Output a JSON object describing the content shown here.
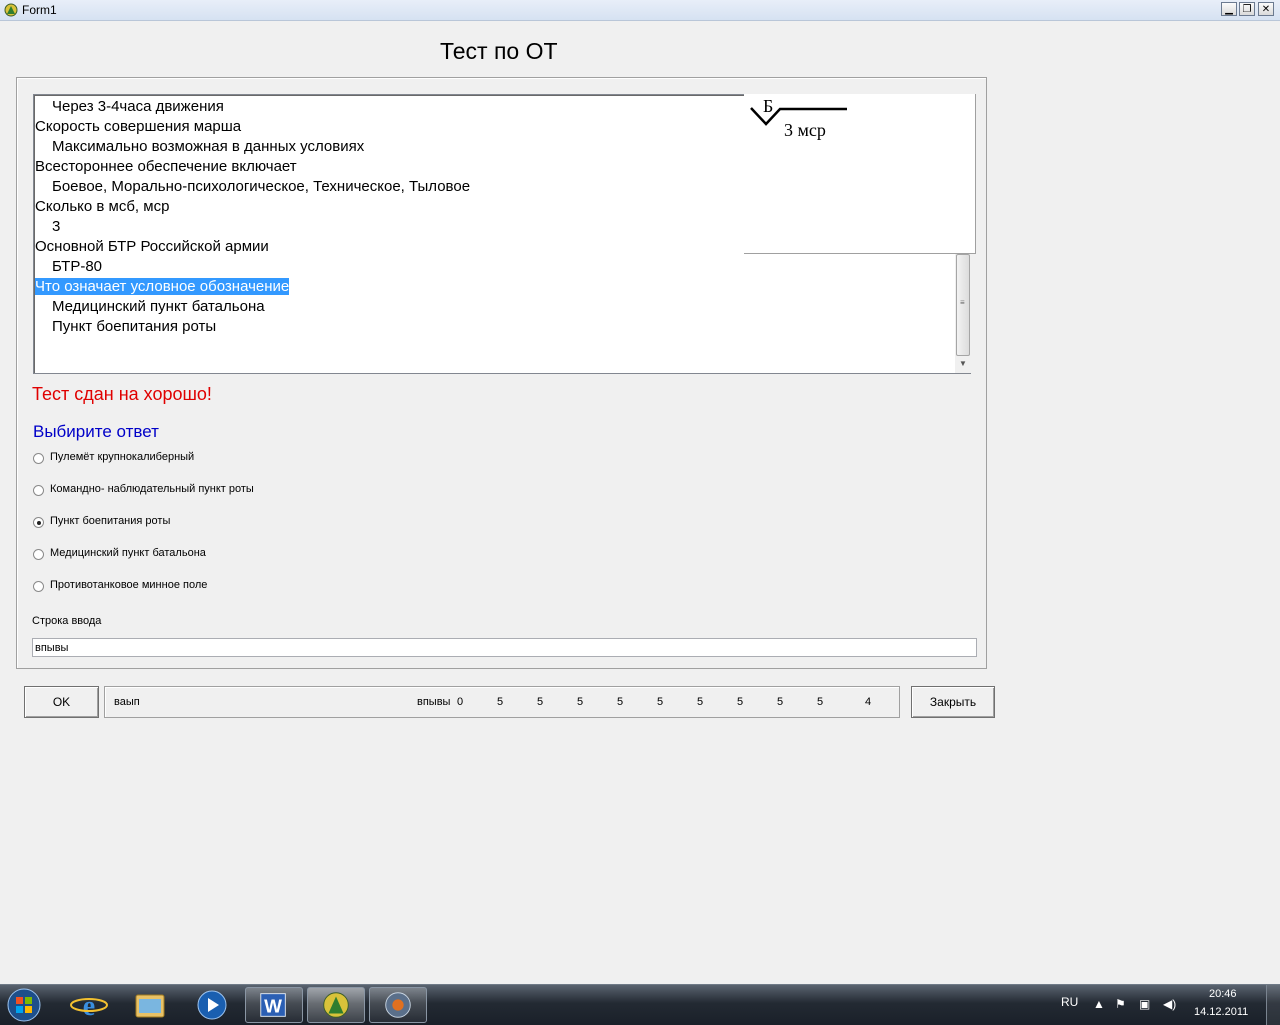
{
  "window": {
    "title": "Form1",
    "icon": "app-icon",
    "controls": {
      "minimize": "minimize-icon",
      "maximize": "restore-icon",
      "close": "close-icon"
    }
  },
  "form_title": "Тест по ОТ",
  "qa_list": [
    {
      "text": "Через 3-4часа движения",
      "type": "answer"
    },
    {
      "text": "Скорость совершения марша",
      "type": "question"
    },
    {
      "text": "Максимально возможная в данных условиях",
      "type": "answer"
    },
    {
      "text": "Всестороннее обеспечение включает",
      "type": "question"
    },
    {
      "text": "Боевое, Морально-психологическое, Техническое, Тыловое",
      "type": "answer"
    },
    {
      "text": "Сколько в мсб, мср",
      "type": "question"
    },
    {
      "text": "3",
      "type": "answer"
    },
    {
      "text": "Основной БТР Российской армии",
      "type": "question"
    },
    {
      "text": "БТР-80",
      "type": "answer"
    },
    {
      "text": "Что означает условное обозначение",
      "type": "question",
      "selected": true
    },
    {
      "text": "Медицинский пункт батальона",
      "type": "answer"
    },
    {
      "text": "Пункт боепитания роты",
      "type": "answer"
    }
  ],
  "symbol": {
    "letter": "Б",
    "label": "3 мср"
  },
  "result_text": "Тест сдан на хорошо!",
  "prompt_text": "Выбирите ответ",
  "options": [
    {
      "label": "Пулемёт крупнокалиберный",
      "checked": false
    },
    {
      "label": "Командно- наблюдательный пункт роты",
      "checked": false
    },
    {
      "label": "Пункт боепитания роты",
      "checked": true
    },
    {
      "label": "Медицинский пункт батальона",
      "checked": false
    },
    {
      "label": "Противотанковое минное поле",
      "checked": false
    }
  ],
  "input": {
    "label": "Строка ввода",
    "value": "впывы"
  },
  "buttons": {
    "ok": "OK",
    "close": "Закрыть"
  },
  "status": {
    "left_text": "ваып",
    "right_label": "впывы",
    "scores": [
      "0",
      "5",
      "5",
      "5",
      "5",
      "5",
      "5",
      "5",
      "5",
      "5",
      "4"
    ]
  },
  "taskbar": {
    "apps": [
      "internet-explorer-icon",
      "file-explorer-icon",
      "media-player-icon",
      "word-icon",
      "app-icon",
      "media-center-icon"
    ],
    "language": "RU",
    "time": "20:46",
    "date": "14.12.2011",
    "tray_icons": [
      "tray-arrow-icon",
      "flag-icon",
      "network-icon",
      "volume-icon"
    ]
  },
  "colors": {
    "result": "#e00000",
    "prompt": "#0000c8",
    "selection": "#3399ff"
  }
}
